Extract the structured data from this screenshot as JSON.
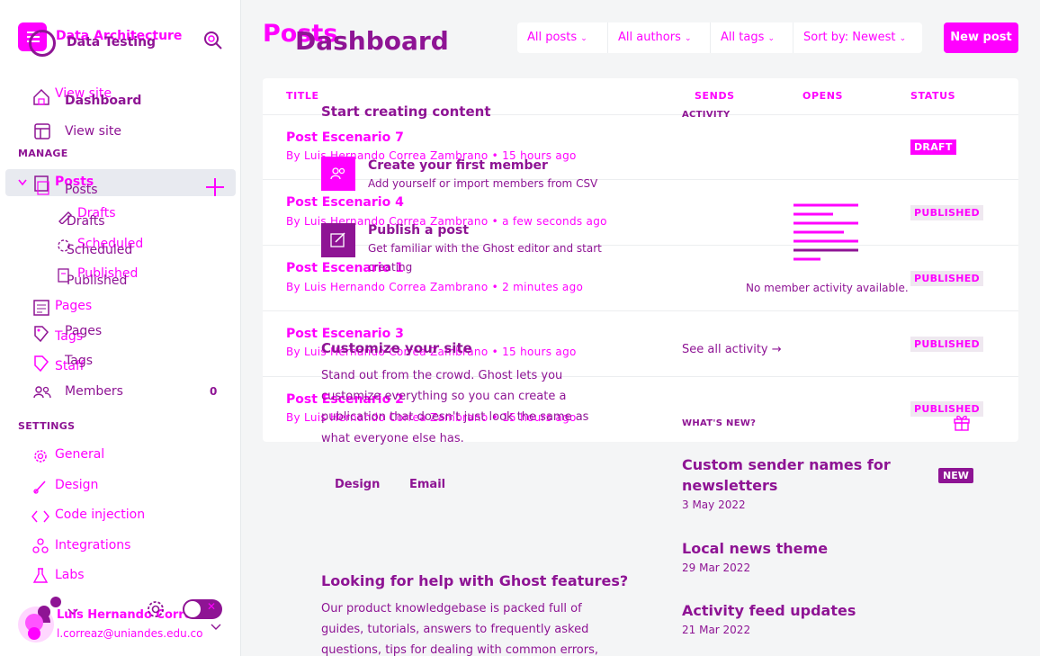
{
  "site": {
    "name": "Data Architecture",
    "subtitle": "Data Testing"
  },
  "sidebar": {
    "top": [
      {
        "label": "View site",
        "ghost": true
      },
      {
        "label": "Dashboard"
      },
      {
        "label": "View site"
      }
    ],
    "manage_label": "MANAGE",
    "posts_label": "Posts",
    "posts_label_dup": "Posts",
    "sub": {
      "drafts": "Drafts",
      "drafts_dup": "Drafts",
      "scheduled": "Scheduled",
      "scheduled_dup": "Scheduled",
      "published": "Published",
      "published_dup": "Published"
    },
    "pages": "Pages",
    "pages_dup": "Pages",
    "tags": "Tags",
    "tags_dup": "Tags",
    "staff": "Staff",
    "members": "Members",
    "members_count": "0",
    "settings_label": "SETTINGS",
    "settings": [
      "General",
      "Design",
      "Code injection",
      "Integrations",
      "Labs"
    ],
    "user": {
      "name": "Luis Hernando Corre...",
      "email": "l.correaz@uniandes.edu.co"
    }
  },
  "header": {
    "title_a": "Posts",
    "title_b": "Dashboard",
    "filters": [
      "All posts",
      "All authors",
      "All tags",
      "Sort by: Newest"
    ],
    "new_post": "New post"
  },
  "table": {
    "columns": {
      "title": "TITLE",
      "sends": "SENDS",
      "opens": "OPENS",
      "status": "STATUS"
    },
    "rows": [
      {
        "title": "Post Escenario 7",
        "meta": "By Luis Hernando Correa Zambrano • 15 hours ago",
        "status": "DRAFT"
      },
      {
        "title": "Post Escenario 4",
        "meta": "By Luis Hernando Correa Zambrano • a few seconds ago",
        "status": "PUBLISHED"
      },
      {
        "title": "Post Escenario 1",
        "meta": "By Luis Hernando Correa Zambrano • 2 minutes ago",
        "status": "PUBLISHED"
      },
      {
        "title": "Post Escenario 3",
        "meta": "By Luis Hernando Correa Zambrano • 15 hours ago",
        "status": "PUBLISHED"
      },
      {
        "title": "Post Escenario 2",
        "meta": "By Luis Hernando Correa Zambrano • 15 hours ago",
        "status": "PUBLISHED"
      }
    ]
  },
  "dashboard": {
    "start_title": "Start creating content",
    "member_title": "Create your first member",
    "member_desc": "Add yourself or import members from CSV",
    "publish_title": "Publish a post",
    "publish_desc_1": "Get familiar with the Ghost editor and start",
    "publish_desc_2": "creating",
    "customize_title": "Customize your site",
    "customize_desc": [
      "Stand out from the crowd. Ghost lets you",
      "customize everything so you can create a",
      "publication that doesn't just look the same as",
      "what everyone else has."
    ],
    "customize_links": [
      "Design",
      "Email"
    ],
    "help_title": "Looking for help with Ghost features?",
    "help_desc": [
      "Our product knowledgebase is packed full of",
      "guides, tutorials, answers to frequently asked",
      "questions, tips for dealing with common errors,"
    ],
    "activity_label": "ACTIVITY",
    "activity_empty": "No member activity available.",
    "activity_link": "See all activity →",
    "whatsnew_label": "WHAT'S NEW?",
    "news": [
      {
        "title_1": "Custom sender names for",
        "title_2": "newsletters",
        "date": "3 May 2022",
        "badge": "NEW"
      },
      {
        "title_1": "Local news theme",
        "date": "29 Mar 2022"
      },
      {
        "title_1": "Activity feed updates",
        "date": "21 Mar 2022"
      }
    ]
  },
  "colors": {
    "accent": "#ff00ff",
    "purple": "#8e1494",
    "sidebar_active": "#e8eaf0",
    "main_bg": "#f4f5f6"
  }
}
